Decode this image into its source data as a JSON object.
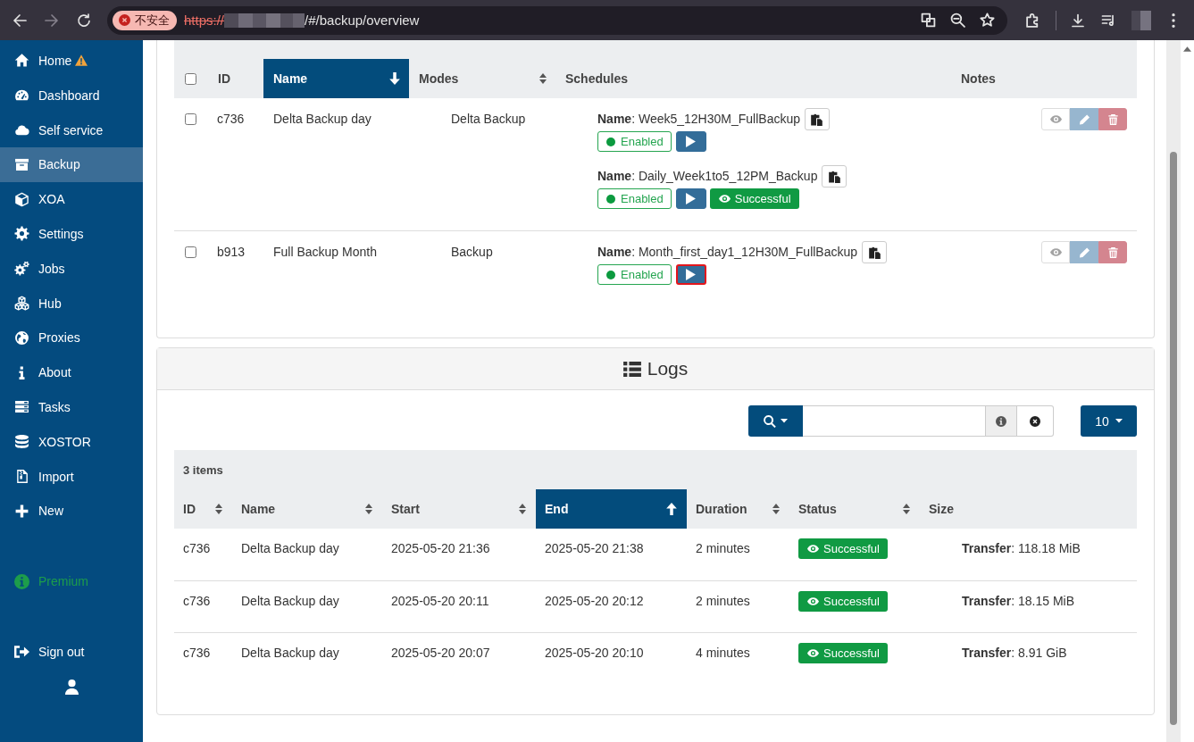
{
  "browser": {
    "security_label": "不安全",
    "url_scheme": "https://",
    "url_path": "/#/backup/overview"
  },
  "sidebar": {
    "items": [
      {
        "label": "Home",
        "warning": true,
        "selected": false
      },
      {
        "label": "Dashboard",
        "warning": false,
        "selected": false
      },
      {
        "label": "Self service",
        "warning": false,
        "selected": false
      },
      {
        "label": "Backup",
        "warning": false,
        "selected": true
      },
      {
        "label": "XOA",
        "warning": false,
        "selected": false
      },
      {
        "label": "Settings",
        "warning": false,
        "selected": false
      },
      {
        "label": "Jobs",
        "warning": false,
        "selected": false
      },
      {
        "label": "Hub",
        "warning": false,
        "selected": false
      },
      {
        "label": "Proxies",
        "warning": false,
        "selected": false
      },
      {
        "label": "About",
        "warning": false,
        "selected": false
      },
      {
        "label": "Tasks",
        "warning": false,
        "selected": false
      },
      {
        "label": "XOSTOR",
        "warning": false,
        "selected": false
      },
      {
        "label": "Import",
        "warning": false,
        "selected": false
      },
      {
        "label": "New",
        "warning": false,
        "selected": false
      }
    ],
    "premium": "Premium",
    "sign_out": "Sign out"
  },
  "backups": {
    "select_all_checked": false,
    "columns": [
      {
        "label": "ID",
        "sortable": false,
        "selected": false
      },
      {
        "label": "Name",
        "sortable": true,
        "selected": true,
        "descending": true
      },
      {
        "label": "Modes",
        "sortable": true,
        "selected": false
      },
      {
        "label": "Schedules",
        "sortable": false,
        "selected": false
      },
      {
        "label": "Notes",
        "sortable": false,
        "selected": false
      }
    ],
    "rows": [
      {
        "id": "c736",
        "name": "Delta Backup day",
        "mode": "Delta Backup",
        "checked": false,
        "schedules": [
          {
            "name": "**Name**: Week5_12H30M_FullBackup",
            "status": "Enabled",
            "enabled": true,
            "run_outlined": false
          },
          {
            "name": "**Name**: Daily_Week1to5_12PM_Backup",
            "status": "Enabled",
            "enabled": true,
            "run_outlined": false,
            "last_run": "Successful"
          }
        ]
      },
      {
        "id": "b913",
        "name": "Full Backup Month",
        "mode": "Backup",
        "checked": false,
        "schedules": [
          {
            "name": "**Name**: Month_first_day1_12H30M_FullBackup",
            "status": "Enabled",
            "enabled": true,
            "run_outlined": true
          }
        ]
      }
    ]
  },
  "logs": {
    "title": "Logs",
    "page_size": "10",
    "count": "3 items",
    "columns": [
      {
        "label": "ID",
        "sortable": true,
        "selected": false
      },
      {
        "label": "Name",
        "sortable": true,
        "selected": false
      },
      {
        "label": "Start",
        "sortable": true,
        "selected": false
      },
      {
        "label": "End",
        "sortable": true,
        "selected": true,
        "descending": false
      },
      {
        "label": "Duration",
        "sortable": true,
        "selected": false
      },
      {
        "label": "Status",
        "sortable": true,
        "selected": false
      },
      {
        "label": "Size",
        "sortable": false,
        "selected": false
      }
    ],
    "rows": [
      {
        "id": "c736",
        "name": "Delta Backup day",
        "start": "2025-05-20 21:36",
        "end": "2025-05-20 21:38",
        "duration": "2 minutes",
        "status": "Successful",
        "size": "**Transfer**: 118.18 MiB"
      },
      {
        "id": "c736",
        "name": "Delta Backup day",
        "start": "2025-05-20 20:11",
        "end": "2025-05-20 20:12",
        "duration": "2 minutes",
        "status": "Successful",
        "size": "**Transfer**: 18.15 MiB"
      },
      {
        "id": "c736",
        "name": "Delta Backup day",
        "start": "2025-05-20 20:07",
        "end": "2025-05-20 20:10",
        "duration": "4 minutes",
        "status": "Successful",
        "size": "**Transfer**: 8.91 GiB"
      }
    ]
  }
}
